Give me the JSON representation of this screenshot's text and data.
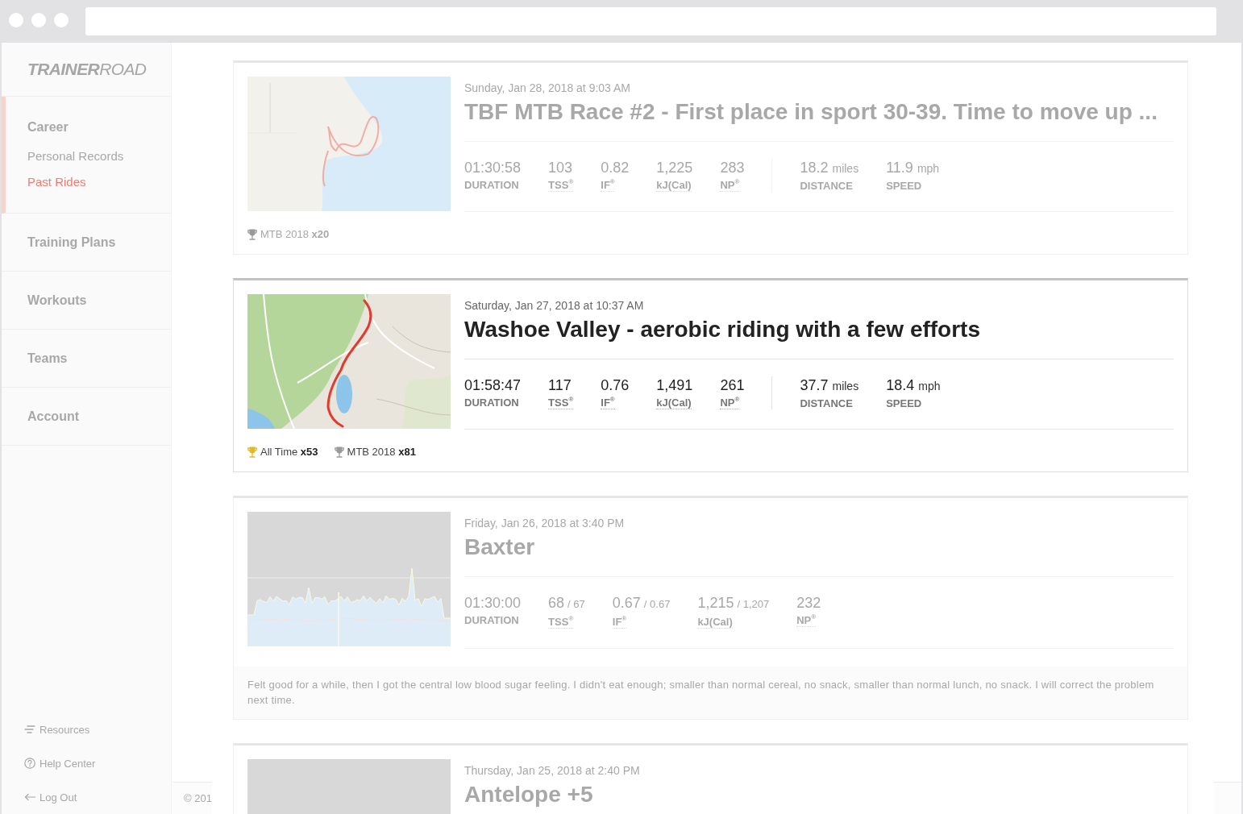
{
  "sidebar": {
    "dimmed": true,
    "logo": "**TRAINER**ROAD",
    "sections": [
      {
        "label": "Career",
        "selected": true,
        "children": [
          {
            "label": "Personal Records",
            "selected": false
          },
          {
            "label": "Past Rides",
            "selected": true
          }
        ]
      },
      {
        "label": "Training Plans",
        "selected": false
      },
      {
        "label": "Workouts",
        "selected": false
      },
      {
        "label": "Teams",
        "selected": false
      },
      {
        "label": "Account",
        "selected": false
      }
    ],
    "links": [
      {
        "kind": "resources",
        "label": "Resources"
      },
      {
        "kind": "help",
        "label": "Help Center"
      },
      {
        "kind": "logout",
        "label": "Log Out"
      }
    ]
  },
  "footer": {
    "dimmed": true,
    "text": "© 201"
  },
  "cards": [
    {
      "dimmed": true,
      "thumbnail": {
        "kind": "map"
      },
      "date": "Sunday, Jan 28, 2018 at 9:03 AM",
      "title": "TBF MTB Race #2 - First place in sport 30-39. Time to move up ...",
      "stats": [
        {
          "kind": "plain",
          "value": "01:30:58",
          "label": "DURATION"
        },
        {
          "kind": "metric",
          "value": "103",
          "label": "TSS$^{®}$"
        },
        {
          "kind": "metric",
          "value": "0.82",
          "label": "IF$^{®}$"
        },
        {
          "kind": "metric",
          "value": "1,225",
          "label": "kJ(Cal)"
        },
        {
          "kind": "metric",
          "value": "283",
          "label": "NP$^{®}$"
        }
      ],
      "route_stats": [
        {
          "value": "18.2",
          "unit": "miles",
          "label": "DISTANCE"
        },
        {
          "value": "11.9",
          "unit": "mph",
          "label": "SPEED"
        }
      ],
      "achievements": [
        {
          "color": "#999999",
          "label": "MTB 2018",
          "count": "x20"
        }
      ]
    },
    {
      "dimmed": false,
      "thumbnail": {
        "kind": "map"
      },
      "date": "Saturday, Jan 27, 2018 at 10:37 AM",
      "title": "Washoe Valley - aerobic riding with a few efforts",
      "stats": [
        {
          "kind": "plain",
          "value": "01:58:47",
          "label": "DURATION"
        },
        {
          "kind": "metric",
          "value": "117",
          "label": "TSS$^{®}$"
        },
        {
          "kind": "metric",
          "value": "0.76",
          "label": "IF$^{®}$"
        },
        {
          "kind": "metric",
          "value": "1,491",
          "label": "kJ(Cal)"
        },
        {
          "kind": "metric",
          "value": "261",
          "label": "NP$^{®}$"
        }
      ],
      "route_stats": [
        {
          "value": "37.7",
          "unit": "miles",
          "label": "DISTANCE"
        },
        {
          "value": "18.4",
          "unit": "mph",
          "label": "SPEED"
        }
      ],
      "achievements": [
        {
          "color": "#e6b820",
          "label": "All Time",
          "count": "x53"
        },
        {
          "color": "#999999",
          "label": "MTB 2018",
          "count": "x81"
        }
      ]
    },
    {
      "dimmed": true,
      "thumbnail": {
        "kind": "workout"
      },
      "date": "Friday, Jan 26, 2018 at 3:40 PM",
      "title": "Baxter",
      "stats": [
        {
          "kind": "plain",
          "value": "01:30:00",
          "label": "DURATION"
        },
        {
          "kind": "metric",
          "value": "68",
          "planned": "/ 67",
          "label": "TSS$^{®}$"
        },
        {
          "kind": "metric",
          "value": "0.67",
          "planned": "/ 0.67",
          "label": "IF$^{®}$"
        },
        {
          "kind": "metric",
          "value": "1,215",
          "planned": "/ 1,207",
          "label": "kJ(Cal)"
        },
        {
          "kind": "metric",
          "value": "232",
          "label": "NP$^{®}$"
        }
      ],
      "note": "Felt good for a while, then I got the central low blood sugar feeling. I didn't eat enough; smaller than normal cereal, no snack, smaller than normal lunch, no snack. I will correct the problem next time."
    },
    {
      "dimmed": true,
      "thumbnail": {
        "kind": "workout"
      },
      "date": "Thursday, Jan 25, 2018 at 2:40 PM",
      "title": "Antelope +5"
    }
  ]
}
